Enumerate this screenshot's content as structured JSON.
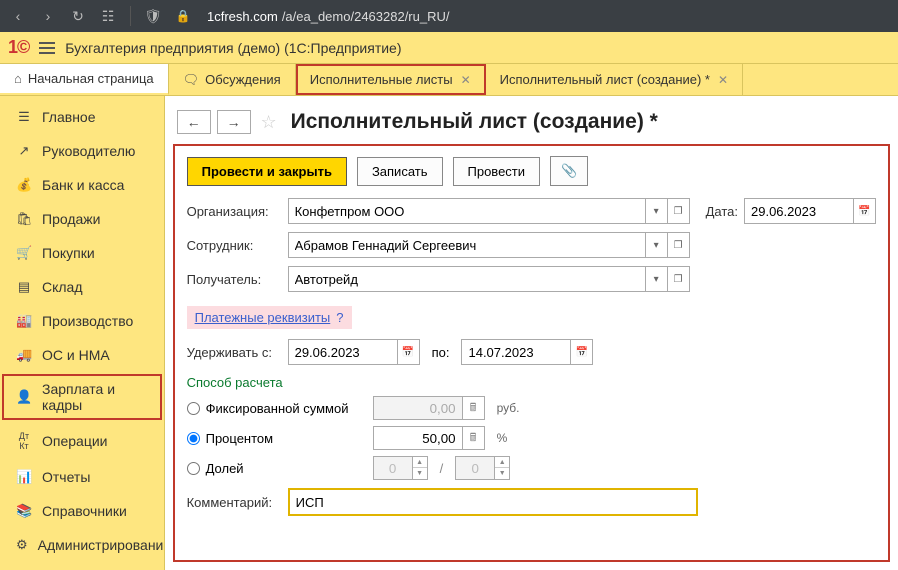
{
  "browser": {
    "url_host": "1cfresh.com",
    "url_path": "/a/ea_demo/2463282/ru_RU/"
  },
  "app": {
    "title": "Бухгалтерия предприятия (демо)  (1С:Предприятие)"
  },
  "tabs": {
    "home": "Начальная страница",
    "discuss": "Обсуждения",
    "list": "Исполнительные листы",
    "form": "Исполнительный лист (создание) *"
  },
  "sidebar": {
    "items": [
      "Главное",
      "Руководителю",
      "Банк и касса",
      "Продажи",
      "Покупки",
      "Склад",
      "Производство",
      "ОС и НМА",
      "Зарплата и кадры",
      "Операции",
      "Отчеты",
      "Справочники",
      "Администрирование"
    ]
  },
  "page": {
    "title": "Исполнительный лист (создание) *"
  },
  "buttons": {
    "post_close": "Провести и закрыть",
    "save": "Записать",
    "post": "Провести"
  },
  "fields": {
    "org_label": "Организация:",
    "org_value": "Конфетпром ООО",
    "date_label": "Дата:",
    "date_value": "29.06.2023",
    "emp_label": "Сотрудник:",
    "emp_value": "Абрамов Геннадий Сергеевич",
    "recv_label": "Получатель:",
    "recv_value": "Автотрейд",
    "payreq_link": "Платежные реквизиты",
    "payreq_q": "?",
    "hold_label": "Удерживать с:",
    "hold_from": "29.06.2023",
    "hold_to_label": "по:",
    "hold_to": "14.07.2023",
    "method_title": "Способ расчета",
    "fixed_label": "Фиксированной суммой",
    "fixed_value": "0,00",
    "fixed_unit": "руб.",
    "percent_label": "Процентом",
    "percent_value": "50,00",
    "percent_unit": "%",
    "share_label": "Долей",
    "share_a": "0",
    "share_sep": "/",
    "share_b": "0",
    "comment_label": "Комментарий:",
    "comment_value": "ИСП"
  }
}
